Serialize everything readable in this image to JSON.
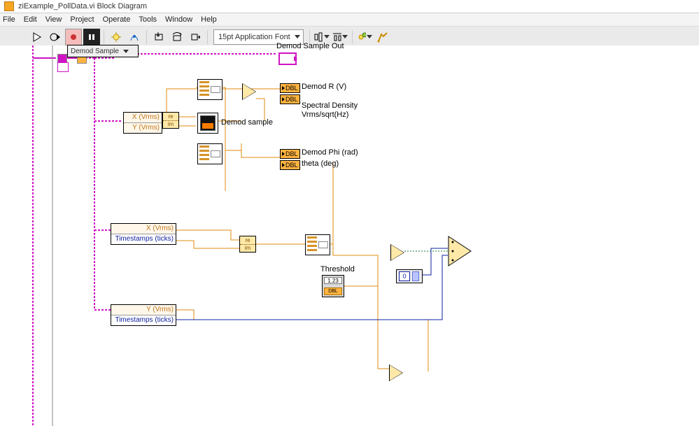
{
  "title": "ziExample_PollData.vi Block Diagram",
  "menu": [
    "File",
    "Edit",
    "View",
    "Project",
    "Operate",
    "Tools",
    "Window",
    "Help"
  ],
  "toolbar": {
    "font": "15pt Application Font"
  },
  "selector": {
    "label": "Demod Sample"
  },
  "out_indicator": {
    "label": "Demod Sample Out"
  },
  "unbundle_xy": {
    "rows": [
      "X (Vrms)",
      "Y (Vrms)"
    ]
  },
  "unbundle_xt": {
    "rows": [
      "X (Vrms)",
      "Timestamps (ticks)"
    ]
  },
  "unbundle_yt": {
    "rows": [
      "Y (Vrms)",
      "Timestamps (ticks)"
    ]
  },
  "dbl_tag": "DBL",
  "terminals": {
    "r": {
      "label": "Demod R (V)"
    },
    "sd": {
      "label_l1": "Spectral Density",
      "label_l2": "Vrms/sqrt(Hz)"
    },
    "chart": {
      "label": "Demod sample"
    },
    "phi": {
      "label": "Demod Phi (rad)"
    },
    "theta": {
      "label": "theta (deg)"
    }
  },
  "cmplx1": {
    "top": "re",
    "bot": "im"
  },
  "threshold": {
    "label": "Threshold",
    "val": "1.23"
  },
  "blue_const": "0"
}
